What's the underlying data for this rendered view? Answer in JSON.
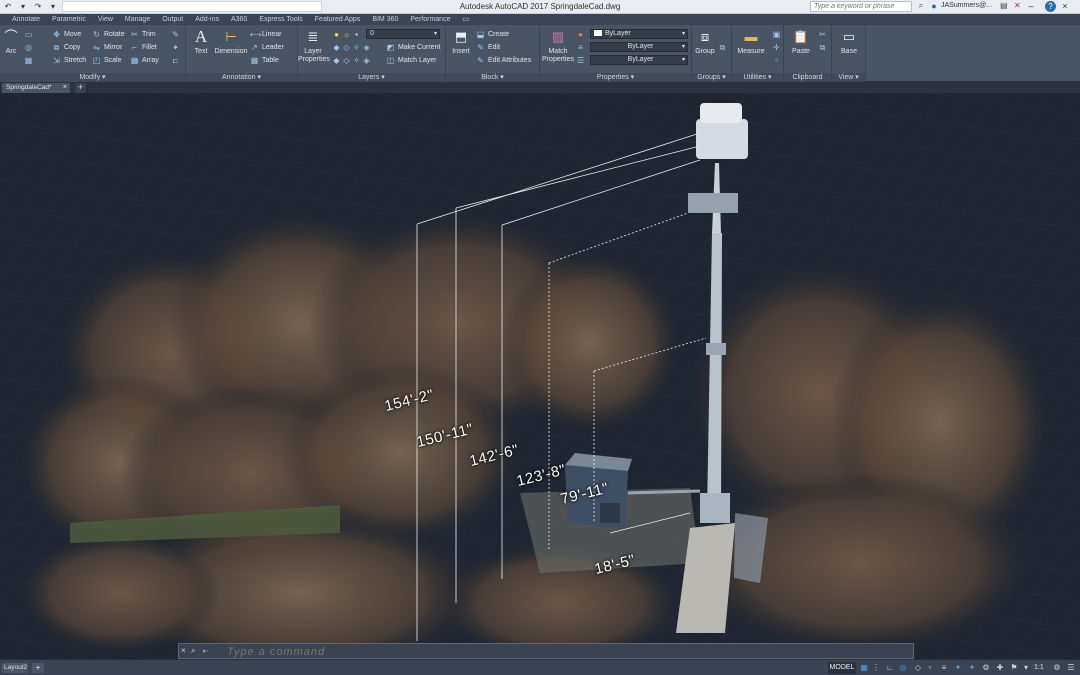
{
  "title_bar": {
    "app_title": "Autodesk AutoCAD 2017   SpringdaleCad.dwg",
    "search_placeholder": "Type a keyword or phrase",
    "user_name": "JASummers@...",
    "help": "?"
  },
  "ribbon_tabs": [
    "Annotate",
    "Parametric",
    "View",
    "Manage",
    "Output",
    "Add-ins",
    "A360",
    "Express Tools",
    "Featured Apps",
    "BIM 360",
    "Performance"
  ],
  "ribbon": {
    "modify": {
      "title": "Modify",
      "arc": "Arc",
      "tools": [
        "Move",
        "Rotate",
        "Trim",
        "Copy",
        "Mirror",
        "Fillet",
        "Stretch",
        "Scale",
        "Array"
      ]
    },
    "annotation": {
      "title": "Annotation",
      "text": "Text",
      "dimension": "Dimension",
      "linear": "Linear",
      "leader": "Leader",
      "table": "Table"
    },
    "layers": {
      "title": "Layers",
      "layer_properties": "Layer Properties",
      "current_layer": "0",
      "make_current": "Make Current",
      "match_layer": "Match Layer"
    },
    "block": {
      "title": "Block",
      "insert": "Insert",
      "create": "Create",
      "edit": "Edit",
      "edit_attributes": "Edit Attributes"
    },
    "properties": {
      "title": "Properties",
      "match_properties": "Match Properties",
      "color": "ByLayer",
      "linetype": "ByLayer",
      "lineweight": "ByLayer"
    },
    "groups": {
      "title": "Groups",
      "group": "Group"
    },
    "utilities": {
      "title": "Utilities",
      "measure": "Measure"
    },
    "clipboard": {
      "title": "Clipboard",
      "paste": "Paste"
    },
    "view": {
      "title": "View",
      "base": "Base"
    }
  },
  "file_tab": {
    "name": "SpringdaleCad*"
  },
  "dimensions": [
    "154'-2\"",
    "150'-11\"",
    "142'-6\"",
    "123'-8\"",
    "79'-11\"",
    "18'-5\""
  ],
  "command_line": {
    "placeholder": "Type a command"
  },
  "status_bar": {
    "layout_tab": "Layout2",
    "model": "MODEL",
    "scale": "1:1"
  }
}
